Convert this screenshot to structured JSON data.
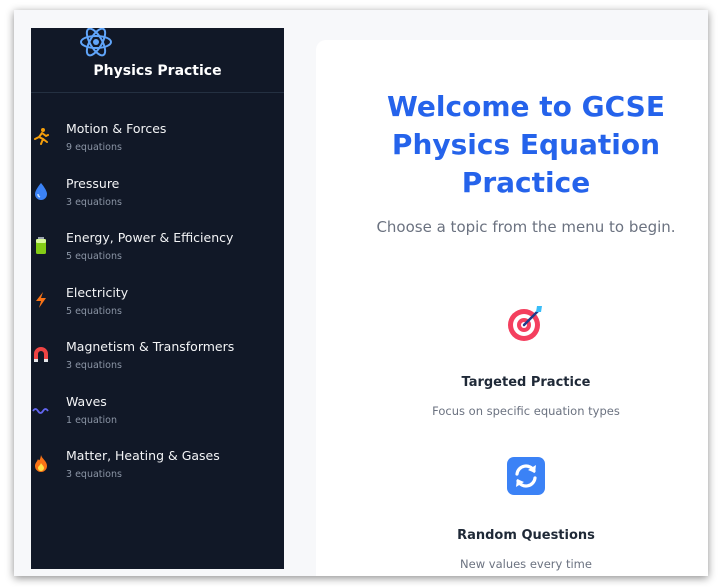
{
  "sidebar": {
    "brand_icon": "atom-icon",
    "title": "Physics Practice",
    "topics": [
      {
        "label": "Motion & Forces",
        "count": "9 equations",
        "icon": "running-person-icon",
        "color": "#f59e0b"
      },
      {
        "label": "Pressure",
        "count": "3 equations",
        "icon": "water-drop-icon",
        "color": "#3b82f6"
      },
      {
        "label": "Energy, Power & Efficiency",
        "count": "5 equations",
        "icon": "battery-icon",
        "color": "#84cc16"
      },
      {
        "label": "Electricity",
        "count": "5 equations",
        "icon": "lightning-icon",
        "color": "#f97316"
      },
      {
        "label": "Magnetism & Transformers",
        "count": "3 equations",
        "icon": "magnet-icon",
        "color": "#ef4444"
      },
      {
        "label": "Waves",
        "count": "1 equation",
        "icon": "wave-icon",
        "color": "#6366f1"
      },
      {
        "label": "Matter, Heating & Gases",
        "count": "3 equations",
        "icon": "fire-icon",
        "color": "#f97316"
      }
    ]
  },
  "main": {
    "welcome_line1": "Welcome to GCSE",
    "welcome_line2": "Physics Equation",
    "welcome_line3": "Practice",
    "subtitle": "Choose a topic from the menu to begin.",
    "features": [
      {
        "title": "Targeted Practice",
        "desc": "Focus on specific equation types",
        "icon": "target-icon"
      },
      {
        "title": "Random Questions",
        "desc": "New values every time",
        "icon": "refresh-icon"
      }
    ]
  },
  "colors": {
    "sidebar_bg": "#111827",
    "accent": "#2563eb"
  }
}
